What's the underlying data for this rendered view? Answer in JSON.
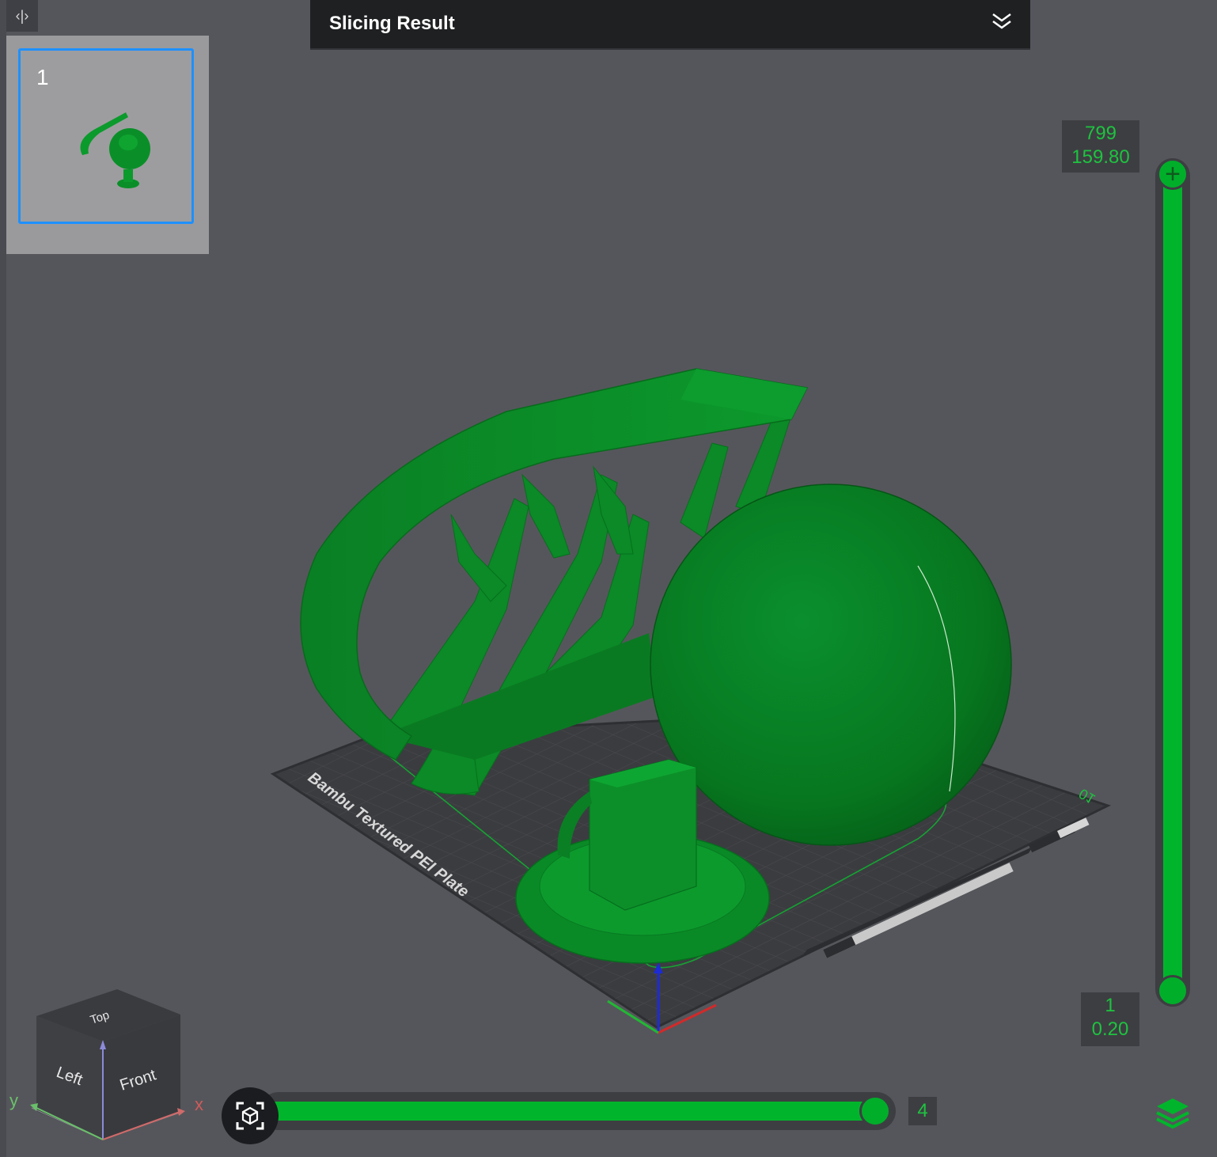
{
  "header": {
    "title": "Slicing Result"
  },
  "sidebar": {
    "collapse_glyph": "‹|›",
    "plates": [
      {
        "number": "1"
      }
    ]
  },
  "plate_label": "Bambu Textured PEI Plate",
  "plate_id": "01",
  "layer_slider": {
    "top_layer": "799",
    "top_height": "159.80",
    "bottom_layer": "1",
    "bottom_height": "0.20"
  },
  "move_slider": {
    "value": "4"
  },
  "view_cube": {
    "top": "Top",
    "left": "Left",
    "front": "Front"
  },
  "axes": {
    "x": "x",
    "y": "y"
  },
  "icons": {
    "collapse": "collapse-panel-icon",
    "header_toggle": "double-chevron-down-icon",
    "camera": "camera-view-icon",
    "layers": "layers-icon"
  },
  "colors": {
    "accent_green": "#00b52b",
    "selection_blue": "#1e90ff",
    "header_bg": "#1f2022"
  }
}
